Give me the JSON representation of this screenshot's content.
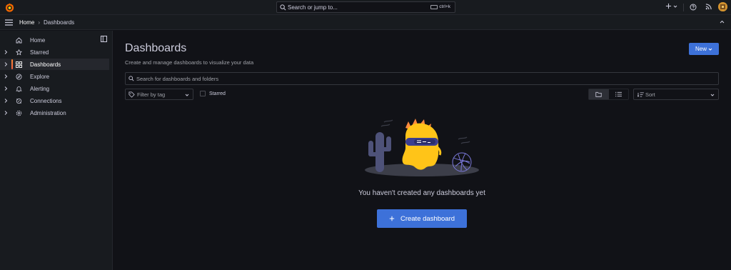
{
  "topbar": {
    "search_placeholder": "Search or jump to...",
    "search_shortcut": "ctrl+k",
    "icons": [
      "grafana-logo-icon",
      "search-icon",
      "plus-icon",
      "help-icon",
      "news-icon",
      "avatar"
    ]
  },
  "breadcrumb": {
    "home": "Home",
    "separator": "›",
    "current": "Dashboards"
  },
  "sidebar": {
    "items": [
      {
        "label": "Home",
        "icon": "home-icon",
        "expandable": false,
        "active": false
      },
      {
        "label": "Starred",
        "icon": "star-icon",
        "expandable": true,
        "active": false
      },
      {
        "label": "Dashboards",
        "icon": "apps-icon",
        "expandable": true,
        "active": true
      },
      {
        "label": "Explore",
        "icon": "compass-icon",
        "expandable": true,
        "active": false
      },
      {
        "label": "Alerting",
        "icon": "bell-icon",
        "expandable": true,
        "active": false
      },
      {
        "label": "Connections",
        "icon": "plug-icon",
        "expandable": true,
        "active": false
      },
      {
        "label": "Administration",
        "icon": "cog-icon",
        "expandable": true,
        "active": false
      }
    ]
  },
  "main": {
    "title": "Dashboards",
    "subtitle": "Create and manage dashboards to visualize your data",
    "new_button": "New",
    "search_placeholder": "Search for dashboards and folders",
    "tag_filter_placeholder": "Filter by tag",
    "starred_label": "Starred",
    "sort_placeholder": "Sort",
    "view_mode": "folder",
    "empty_message": "You haven't created any dashboards yet",
    "create_button": "Create dashboard"
  },
  "colors": {
    "background": "#111217",
    "panel": "#181b1f",
    "primary": "#3d71d9",
    "active_accent": "#ff8833",
    "text": "#ccccdc",
    "muted_text": "#9fa1a8"
  }
}
